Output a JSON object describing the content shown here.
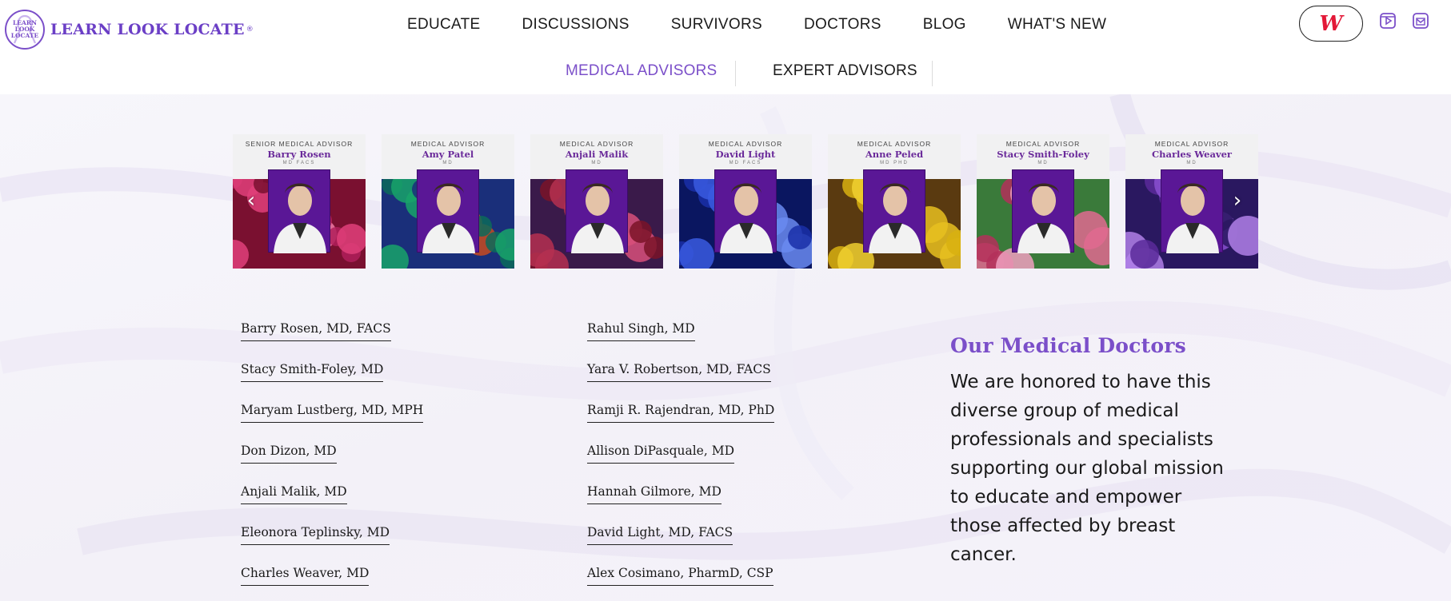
{
  "logo": {
    "mark_lines": [
      "LEARN",
      "LOOK",
      "LOCATE"
    ],
    "wordmark": "LEARN LOOK LOCATE",
    "registered": "®"
  },
  "nav": {
    "items": [
      "EDUCATE",
      "DISCUSSIONS",
      "SURVIVORS",
      "DOCTORS",
      "BLOG",
      "WHAT'S NEW"
    ]
  },
  "header_actions": {
    "partner_button_label": "W",
    "icons": [
      "video-icon",
      "mail-icon"
    ]
  },
  "subnav": {
    "active": "MEDICAL ADVISORS",
    "inactive": "EXPERT ADVISORS"
  },
  "carousel": {
    "prev_label": "‹",
    "next_label": "›",
    "cards": [
      {
        "role": "SENIOR MEDICAL ADVISOR",
        "name": "Barry Rosen",
        "cred": "MD FACS",
        "theme": "pink-flowers",
        "portrait_bg": "#5a1796"
      },
      {
        "role": "MEDICAL ADVISOR",
        "name": "Amy Patel",
        "cred": "MD",
        "theme": "peacock",
        "portrait_bg": "#5a1796"
      },
      {
        "role": "MEDICAL ADVISOR",
        "name": "Anjali Malik",
        "cred": "MD",
        "theme": "red-abstract",
        "portrait_bg": "#5a1796"
      },
      {
        "role": "MEDICAL ADVISOR",
        "name": "David Light",
        "cred": "MD FACS",
        "theme": "blue-rose",
        "portrait_bg": "#5a1796"
      },
      {
        "role": "MEDICAL ADVISOR",
        "name": "Anne Peled",
        "cred": "MD PHD",
        "theme": "sunflowers",
        "portrait_bg": "#5a1796"
      },
      {
        "role": "MEDICAL ADVISOR",
        "name": "Stacy Smith-Foley",
        "cred": "MD",
        "theme": "rose-bouquet",
        "portrait_bg": "#5a1796"
      },
      {
        "role": "MEDICAL ADVISOR",
        "name": "Charles Weaver",
        "cred": "MD",
        "theme": "daisies",
        "portrait_bg": "#5a1796"
      }
    ]
  },
  "doctors": {
    "column_1": [
      "Barry Rosen, MD, FACS",
      "Stacy Smith-Foley, MD",
      "Maryam Lustberg, MD, MPH",
      "Don Dizon, MD",
      "Anjali Malik, MD",
      "Eleonora Teplinsky, MD",
      "Charles Weaver, MD"
    ],
    "column_2": [
      "Rahul Singh, MD",
      "Yara V. Robertson, MD, FACS",
      "Ramji R. Rajendran, MD, PhD",
      "Allison DiPasquale, MD",
      "Hannah Gilmore, MD",
      "David Light, MD, FACS",
      "Alex Cosimano, PharmD, CSP"
    ]
  },
  "intro": {
    "title": "Our Medical Doctors",
    "body": "We are honored to have this diverse group of medical professionals and specialists supporting our global mission to educate and empower those affected by breast cancer."
  },
  "colors": {
    "brand_purple": "#7b4fc9",
    "portrait_purple": "#5a1796",
    "partner_red": "#e31837"
  }
}
